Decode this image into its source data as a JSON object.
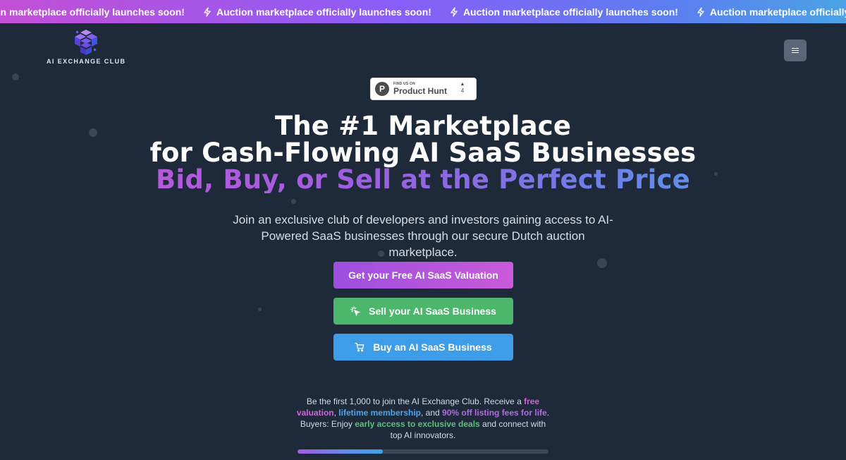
{
  "announcement": {
    "text": "Auction marketplace officially launches soon!",
    "icon": "lightning-bolt-icon",
    "repeat": 5
  },
  "header": {
    "logo_text": "AI EXCHANGE CLUB",
    "menu_icon": "hamburger-menu-icon"
  },
  "product_hunt": {
    "small_text": "FIND US ON",
    "name": "Product Hunt",
    "letter": "P",
    "upvote_arrow": "▲",
    "votes": "4"
  },
  "hero": {
    "line1": "The #1 Marketplace",
    "line2": "for Cash-Flowing AI SaaS Businesses",
    "line3": "Bid, Buy, or Sell at the Perfect Price",
    "subtitle": "Join an exclusive club of developers and investors gaining access to AI-Powered SaaS businesses through our secure Dutch auction marketplace."
  },
  "buttons": {
    "valuation": "Get your Free AI SaaS Valuation",
    "sell": "Sell your AI SaaS Business",
    "sell_icon": "sparkle-cursor-icon",
    "buy": "Buy an AI SaaS Business",
    "buy_icon": "shopping-cart-icon"
  },
  "blurb": {
    "p1": "Be the first 1,000 to join the AI Exchange Club. Receive a ",
    "free_valuation": "free valuation",
    "p2": ", ",
    "lifetime_membership": "lifetime membership",
    "p3": ", and ",
    "fees": "90% off listing fees for life",
    "p4": ". Buyers: Enjoy ",
    "early_access": "early access to exclusive deals",
    "p5": " and connect with top AI innovators."
  },
  "progress": {
    "fraction": 0.34
  },
  "colors": {
    "background": "#1e2a3a",
    "accent_purple": "#9d4fe0",
    "accent_green": "#4cb66a",
    "accent_blue": "#3e9de8",
    "accent_pink": "#d163d8"
  }
}
